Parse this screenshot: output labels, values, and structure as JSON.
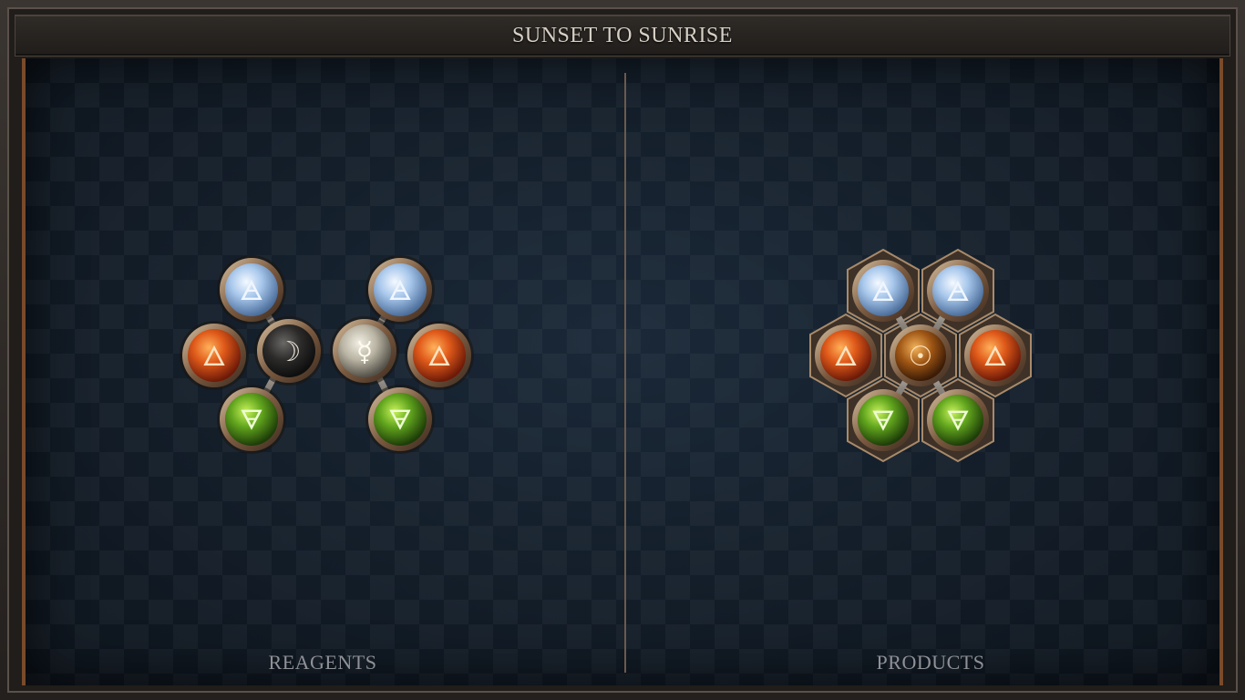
{
  "title": "SUNSET TO SUNRISE",
  "panels": {
    "reagents": {
      "label": "REAGENTS"
    },
    "products": {
      "label": "PRODUCTS"
    }
  },
  "element_symbols": {
    "air": "🜁",
    "fire": "🜂",
    "earth": "🜃",
    "moon": "☽",
    "mercury": "☿",
    "gold": "☉"
  },
  "colors": {
    "air": "#a9c8ec",
    "fire": "#d0451a",
    "earth": "#5a9a1e",
    "moon": "#2c2b2a",
    "mercury": "#bfbaa9",
    "gold": "#b0631a",
    "frame_bronze": "#7a4a2a",
    "board": "#141d27"
  }
}
